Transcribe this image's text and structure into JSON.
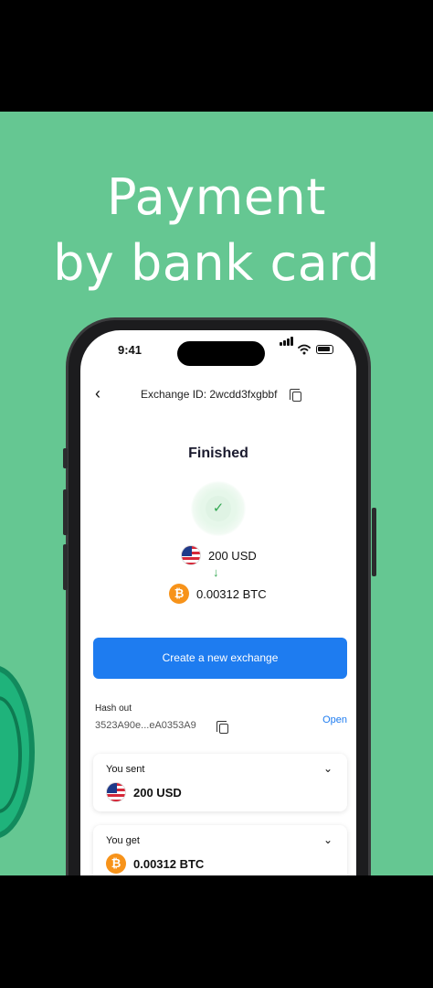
{
  "headline": {
    "line1": "Payment",
    "line2": "by bank card"
  },
  "phone": {
    "status_bar": {
      "time": "9:41"
    },
    "header": {
      "back_icon": "chevron-left-icon",
      "exchange_id": "Exchange ID: 2wcdd3fxgbbf",
      "copy_icon": "copy-icon"
    },
    "status": {
      "title": "Finished",
      "icon": "check-icon"
    },
    "amounts": {
      "sent": "200 USD",
      "received": "0.00312 BTC",
      "arrow": "↓"
    },
    "create_button": "Create a new exchange",
    "hash_out": {
      "label": "Hash out",
      "value": "3523A90e...eA0353A9",
      "open_link": "Open"
    },
    "you_sent": {
      "label": "You sent",
      "value": "200 USD"
    },
    "you_get": {
      "label": "You get",
      "value": "0.00312 BTC"
    }
  },
  "colors": {
    "background": "#65c792",
    "accent": "#1e7cf0",
    "success": "#34a853",
    "bitcoin": "#f7931a"
  }
}
